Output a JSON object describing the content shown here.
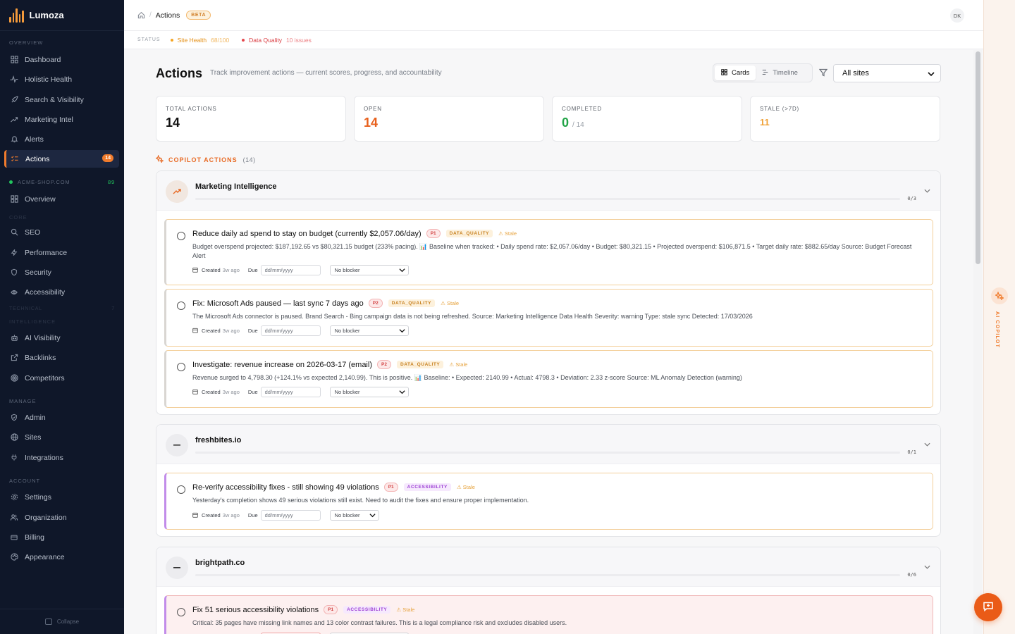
{
  "app": {
    "name": "Lumoza"
  },
  "sidebar": {
    "overview_label": "OVERVIEW",
    "overview_items": [
      {
        "label": "Dashboard",
        "icon": "dashboard-icon"
      },
      {
        "label": "Holistic Health",
        "icon": "pulse-icon"
      },
      {
        "label": "Search & Visibility",
        "icon": "rocket-icon"
      },
      {
        "label": "Marketing Intel",
        "icon": "trend-icon"
      },
      {
        "label": "Alerts",
        "icon": "bell-icon"
      },
      {
        "label": "Actions",
        "icon": "checklist-icon",
        "badge": "14"
      }
    ],
    "site": {
      "name": "ACME-SHOP.COM",
      "score": "89"
    },
    "site_overview": "Overview",
    "core_label": "CORE",
    "core_items": [
      {
        "label": "SEO",
        "icon": "search-icon"
      },
      {
        "label": "Performance",
        "icon": "bolt-icon"
      },
      {
        "label": "Security",
        "icon": "shield-icon"
      },
      {
        "label": "Accessibility",
        "icon": "eye-icon"
      }
    ],
    "technical_label": "TECHNICAL",
    "technical_count": "7",
    "intelligence_label": "INTELLIGENCE",
    "intelligence_items": [
      {
        "label": "AI Visibility",
        "icon": "robot-icon"
      },
      {
        "label": "Backlinks",
        "icon": "external-link-icon"
      },
      {
        "label": "Competitors",
        "icon": "target-icon"
      }
    ],
    "manage_label": "MANAGE",
    "manage_items": [
      {
        "label": "Admin",
        "icon": "shield-check-icon"
      },
      {
        "label": "Sites",
        "icon": "globe-icon"
      },
      {
        "label": "Integrations",
        "icon": "plug-icon"
      }
    ],
    "account_label": "ACCOUNT",
    "account_items": [
      {
        "label": "Settings",
        "icon": "gear-icon"
      },
      {
        "label": "Organization",
        "icon": "users-icon"
      },
      {
        "label": "Billing",
        "icon": "card-icon"
      },
      {
        "label": "Appearance",
        "icon": "palette-icon"
      }
    ],
    "collapse_label": "Collapse"
  },
  "topbar": {
    "breadcrumb_current": "Actions",
    "beta_label": "BETA",
    "avatar_initials": "DK"
  },
  "status": {
    "label": "STATUS",
    "site_health_label": "Site Health",
    "site_health_value": "68/100",
    "data_quality_label": "Data Quality",
    "data_quality_value": "10 issues"
  },
  "page": {
    "title": "Actions",
    "subtitle": "Track improvement actions — current scores, progress, and accountability",
    "view_cards": "Cards",
    "view_timeline": "Timeline",
    "site_filter": "All sites"
  },
  "stats": {
    "total_label": "TOTAL ACTIONS",
    "total_value": "14",
    "open_label": "OPEN",
    "open_value": "14",
    "completed_label": "COMPLETED",
    "completed_value": "0",
    "completed_of": "/ 14",
    "stale_label": "STALE (>7D)",
    "stale_value": "11"
  },
  "copilot": {
    "label": "COPILOT ACTIONS",
    "count": "(14)"
  },
  "labels": {
    "created": "Created",
    "created_ago": "3w ago",
    "due": "Due",
    "date_placeholder": "dd/mm/yyyy",
    "blocker": "No blocker",
    "stale": "Stale"
  },
  "groups": [
    {
      "title": "Marketing Intelligence",
      "progress": "0/3",
      "items": [
        {
          "title": "Reduce daily ad spend to stay on budget (currently $2,057.06/day)",
          "priority": "P1",
          "tag": "DATA_QUALITY",
          "description": "Budget overspend projected: $187,192.65 vs $80,321.15 budget (233% pacing). 📊 Baseline when tracked: • Daily spend rate: $2,057.06/day • Budget: $80,321.15 • Projected overspend: $106,871.5 • Target daily rate: $882.65/day Source: Budget Forecast Alert"
        },
        {
          "title": "Fix: Microsoft Ads paused — last sync 7 days ago",
          "priority": "P2",
          "tag": "DATA_QUALITY",
          "description": "The Microsoft Ads connector is paused. Brand Search - Bing campaign data is not being refreshed. Source: Marketing Intelligence Data Health Severity: warning Type: stale sync Detected: 17/03/2026"
        },
        {
          "title": "Investigate: revenue increase on 2026-03-17 (email)",
          "priority": "P2",
          "tag": "DATA_QUALITY",
          "description": "Revenue surged to 4,798.30 (+124.1% vs expected 2,140.99). This is positive. 📊 Baseline: • Expected: 2140.99 • Actual: 4798.3 • Deviation: 2.33 z-score Source: ML Anomaly Detection (warning)"
        }
      ]
    },
    {
      "title": "freshbites.io",
      "progress": "0/1",
      "items": [
        {
          "title": "Re-verify accessibility fixes - still showing 49 violations",
          "priority": "P1",
          "tag": "ACCESSIBILITY",
          "description": "Yesterday's completion shows 49 serious violations still exist. Need to audit the fixes and ensure proper implementation."
        }
      ]
    },
    {
      "title": "brightpath.co",
      "progress": "0/6",
      "items": [
        {
          "title": "Fix 51 serious accessibility violations",
          "priority": "P1",
          "tag": "ACCESSIBILITY",
          "description": "Critical: 35 pages have missing link names and 13 color contrast failures. This is a legal compliance risk and excludes disabled users."
        }
      ]
    }
  ],
  "rail": {
    "label": "AI COPILOT"
  },
  "colors": {
    "accent": "#f07b2c",
    "sidebar_bg": "#0f1729",
    "health": "#f5a623",
    "quality": "#e5484d",
    "completed": "#22a447"
  }
}
